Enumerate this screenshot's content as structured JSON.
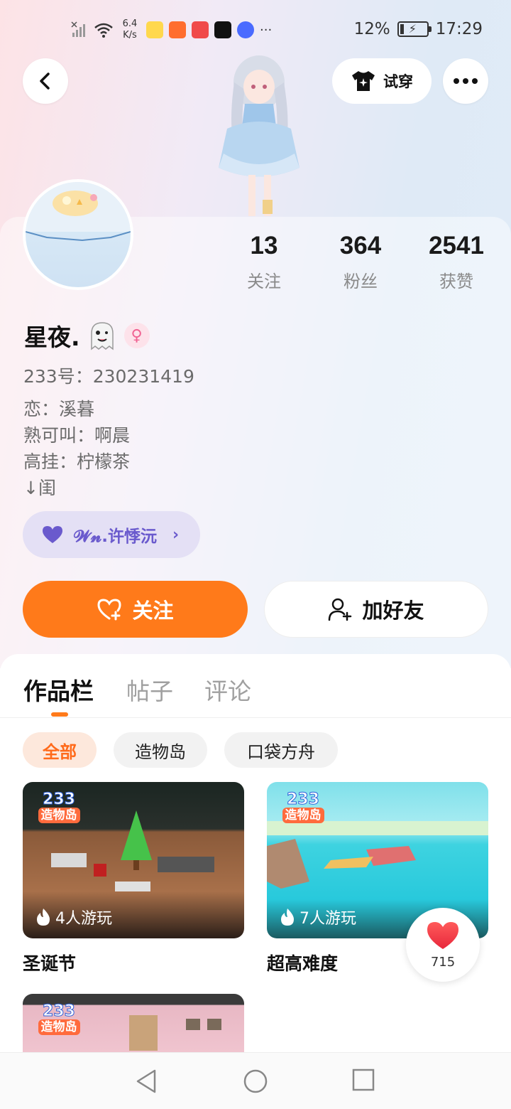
{
  "status_bar": {
    "net_speed_value": "6.4",
    "net_speed_unit": "K/s",
    "more_indicator": "···",
    "battery": "12%",
    "time": "17:29"
  },
  "header": {
    "tryon_label": "试穿"
  },
  "profile": {
    "stats": [
      {
        "value": "13",
        "label": "关注"
      },
      {
        "value": "364",
        "label": "粉丝"
      },
      {
        "value": "2541",
        "label": "获赞"
      }
    ],
    "name": "星夜.",
    "gender_symbol": "♀",
    "uid": "233号：230231419",
    "bio_lines": [
      "恋：溪暮",
      "熟可叫：啊晨",
      "高挂：柠檬茶",
      "↓闺"
    ],
    "couple_name": "𝓦𝓷.许悸沅"
  },
  "actions": {
    "follow_label": "关注",
    "add_friend_label": "加好友"
  },
  "tabs": [
    "作品栏",
    "帖子",
    "评论"
  ],
  "filters": [
    "全部",
    "造物岛",
    "口袋方舟"
  ],
  "logo": {
    "line1": "233",
    "line2": "造物岛"
  },
  "works": [
    {
      "title": "圣诞节",
      "plays": "4人游玩"
    },
    {
      "title": "超高难度",
      "plays": "7人游玩"
    },
    {
      "title": "",
      "plays": ""
    }
  ],
  "like_fab": {
    "count": "715"
  },
  "colors": {
    "accent": "#ff7a1a",
    "couple_tag_bg": "#e4e0f5",
    "couple_tag_fg": "#6a5acd"
  }
}
